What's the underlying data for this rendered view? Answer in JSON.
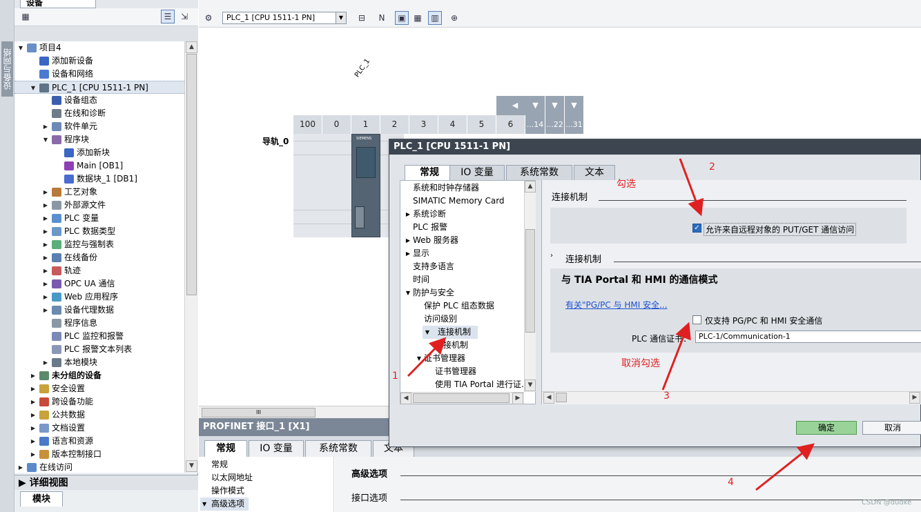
{
  "side_tab": "设备与网络",
  "tree_panel": {
    "title": "设备"
  },
  "tree": [
    {
      "label": "项目4",
      "indent": 0,
      "tw": "▼",
      "icon": "#6a8fc8",
      "bold": false
    },
    {
      "label": "添加新设备",
      "indent": 1,
      "tw": "",
      "icon": "#3a66c4",
      "bold": false
    },
    {
      "label": "设备和网络",
      "indent": 1,
      "tw": "",
      "icon": "#4b7bd0",
      "bold": false
    },
    {
      "label": "PLC_1 [CPU 1511-1 PN]",
      "indent": 1,
      "tw": "▼",
      "icon": "#5f7486",
      "bold": false,
      "sel": true
    },
    {
      "label": "设备组态",
      "indent": 2,
      "tw": "",
      "icon": "#3b5fae",
      "bold": false
    },
    {
      "label": "在线和诊断",
      "indent": 2,
      "tw": "",
      "icon": "#6e7c8a",
      "bold": false
    },
    {
      "label": "软件单元",
      "indent": 2,
      "tw": "▶",
      "icon": "#6d89b8",
      "bold": false
    },
    {
      "label": "程序块",
      "indent": 2,
      "tw": "▼",
      "icon": "#8a6aa8",
      "bold": false
    },
    {
      "label": "添加新块",
      "indent": 3,
      "tw": "",
      "icon": "#3a66c4",
      "bold": false
    },
    {
      "label": "Main [OB1]",
      "indent": 3,
      "tw": "",
      "icon": "#8d3fb5",
      "bold": false
    },
    {
      "label": "数据块_1 [DB1]",
      "indent": 3,
      "tw": "",
      "icon": "#4b6bd0",
      "bold": false
    },
    {
      "label": "工艺对象",
      "indent": 2,
      "tw": "▶",
      "icon": "#b87a3a",
      "bold": false
    },
    {
      "label": "外部源文件",
      "indent": 2,
      "tw": "▶",
      "icon": "#8a98a6",
      "bold": false
    },
    {
      "label": "PLC 变量",
      "indent": 2,
      "tw": "▶",
      "icon": "#5a8fd0",
      "bold": false
    },
    {
      "label": "PLC 数据类型",
      "indent": 2,
      "tw": "▶",
      "icon": "#6a98c8",
      "bold": false
    },
    {
      "label": "监控与强制表",
      "indent": 2,
      "tw": "▶",
      "icon": "#5ab07a",
      "bold": false
    },
    {
      "label": "在线备份",
      "indent": 2,
      "tw": "▶",
      "icon": "#5a7fb0",
      "bold": false
    },
    {
      "label": "轨迹",
      "indent": 2,
      "tw": "▶",
      "icon": "#c85a5a",
      "bold": false
    },
    {
      "label": "OPC UA 通信",
      "indent": 2,
      "tw": "▶",
      "icon": "#7a5ab0",
      "bold": false
    },
    {
      "label": "Web 应用程序",
      "indent": 2,
      "tw": "▶",
      "icon": "#4a9ac8",
      "bold": false
    },
    {
      "label": "设备代理数据",
      "indent": 2,
      "tw": "▶",
      "icon": "#6a8ab0",
      "bold": false
    },
    {
      "label": "程序信息",
      "indent": 2,
      "tw": "",
      "icon": "#8a98a6",
      "bold": false
    },
    {
      "label": "PLC 监控和报警",
      "indent": 2,
      "tw": "",
      "icon": "#7a8ab8",
      "bold": false
    },
    {
      "label": "PLC 报警文本列表",
      "indent": 2,
      "tw": "",
      "icon": "#8a98b8",
      "bold": false
    },
    {
      "label": "本地模块",
      "indent": 2,
      "tw": "▶",
      "icon": "#6a7a8a",
      "bold": false
    },
    {
      "label": "未分组的设备",
      "indent": 1,
      "tw": "▶",
      "icon": "#5a8a6a",
      "bold": true
    },
    {
      "label": "安全设置",
      "indent": 1,
      "tw": "▶",
      "icon": "#c8a23a",
      "bold": false
    },
    {
      "label": "跨设备功能",
      "indent": 1,
      "tw": "▶",
      "icon": "#c84a3a",
      "bold": false
    },
    {
      "label": "公共数据",
      "indent": 1,
      "tw": "▶",
      "icon": "#c8a23a",
      "bold": false
    },
    {
      "label": "文档设置",
      "indent": 1,
      "tw": "▶",
      "icon": "#7a98c8",
      "bold": false
    },
    {
      "label": "语言和资源",
      "indent": 1,
      "tw": "▶",
      "icon": "#4a7ac8",
      "bold": false
    },
    {
      "label": "版本控制接口",
      "indent": 1,
      "tw": "▶",
      "icon": "#c8903a",
      "bold": false
    },
    {
      "label": "在线访问",
      "indent": 0,
      "tw": "▶",
      "icon": "#5a8ac8",
      "bold": false
    }
  ],
  "detail_view": {
    "title": "详细视图",
    "tab": "模块"
  },
  "device_toolbar": {
    "device_select": "PLC_1 [CPU 1511-1 PN]"
  },
  "canvas": {
    "plc_label": "PLC_1",
    "rail_label": "导轨_0",
    "slots": [
      "100",
      "0",
      "1",
      "2",
      "3",
      "4",
      "5",
      "6",
      "...14",
      "...22",
      "...31"
    ],
    "cpu_brand": "SIEMENS"
  },
  "properties": {
    "title": "PROFINET 接口_1 [X1]",
    "tabs": [
      "常规",
      "IO 变量",
      "系统常数",
      "文本"
    ],
    "nav": [
      "常规",
      "以太网地址",
      "操作模式",
      "高级选项"
    ],
    "sections": [
      "高级选项",
      "接口选项"
    ]
  },
  "dialog": {
    "title": "PLC_1 [CPU 1511-1 PN]",
    "tabs": [
      "常规",
      "IO 变量",
      "系统常数",
      "文本"
    ],
    "nav": [
      {
        "label": "系统和时钟存储器",
        "indent": 0,
        "tw": ""
      },
      {
        "label": "SIMATIC Memory Card",
        "indent": 0,
        "tw": ""
      },
      {
        "label": "系统诊断",
        "indent": 0,
        "tw": "▶"
      },
      {
        "label": "PLC 报警",
        "indent": 0,
        "tw": ""
      },
      {
        "label": "Web 服务器",
        "indent": 0,
        "tw": "▶"
      },
      {
        "label": "显示",
        "indent": 0,
        "tw": "▶"
      },
      {
        "label": "支持多语言",
        "indent": 0,
        "tw": ""
      },
      {
        "label": "时间",
        "indent": 0,
        "tw": ""
      },
      {
        "label": "防护与安全",
        "indent": 0,
        "tw": "▼"
      },
      {
        "label": "保护 PLC 组态数据",
        "indent": 1,
        "tw": ""
      },
      {
        "label": "访问级别",
        "indent": 1,
        "tw": ""
      },
      {
        "label": "连接机制",
        "indent": 1,
        "tw": "▼",
        "sel": true
      },
      {
        "label": "连接机制",
        "indent": 2,
        "tw": ""
      },
      {
        "label": "证书管理器",
        "indent": 1,
        "tw": "▼"
      },
      {
        "label": "证书管理器",
        "indent": 2,
        "tw": ""
      },
      {
        "label": "使用 TIA Portal 进行证...",
        "indent": 2,
        "tw": ""
      }
    ],
    "content": {
      "section1": "连接机制",
      "permit_put_get": "允许来自远程对象的 PUT/GET 通信访问",
      "permit_put_get_checked": true,
      "section2": "连接机制",
      "section3": "与 TIA Portal 和 HMI 的通信模式",
      "link": "有关\"PG/PC 与 HMI 安全...",
      "only_secure": "仅支持 PG/PC 和 HMI 安全通信",
      "only_secure_checked": false,
      "cert_label": "PLC 通信证书：",
      "cert_value": "PLC-1/Communication-1"
    },
    "ok": "确定",
    "cancel": "取消"
  },
  "annotations": {
    "check": "勾选",
    "uncheck": "取消勾选",
    "n1": "1",
    "n2": "2",
    "n3": "3",
    "n4": "4",
    "color": "#e02020"
  },
  "watermark": "CSDN @dudke"
}
